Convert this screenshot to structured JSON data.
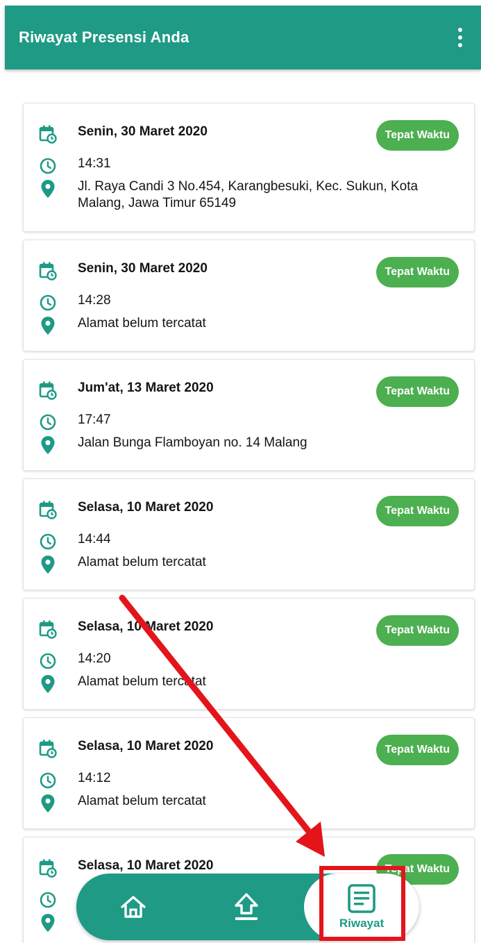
{
  "appbar": {
    "title": "Riwayat Presensi Anda",
    "menu_icon": "more-vert-icon"
  },
  "records": [
    {
      "date": "Senin, 30 Maret 2020",
      "time": "14:31",
      "address": "Jl. Raya Candi 3 No.454, Karangbesuki, Kec. Sukun, Kota Malang, Jawa Timur 65149",
      "status": "Tepat Waktu"
    },
    {
      "date": "Senin, 30 Maret 2020",
      "time": "14:28",
      "address": "Alamat belum tercatat",
      "status": "Tepat Waktu"
    },
    {
      "date": "Jum'at, 13 Maret 2020",
      "time": "17:47",
      "address": "Jalan Bunga Flamboyan no. 14 Malang",
      "status": "Tepat Waktu"
    },
    {
      "date": "Selasa, 10 Maret 2020",
      "time": "14:44",
      "address": "Alamat belum tercatat",
      "status": "Tepat Waktu"
    },
    {
      "date": "Selasa, 10 Maret 2020",
      "time": "14:20",
      "address": "Alamat belum tercatat",
      "status": "Tepat Waktu"
    },
    {
      "date": "Selasa, 10 Maret 2020",
      "time": "14:12",
      "address": "Alamat belum tercatat",
      "status": "Tepat Waktu"
    },
    {
      "date": "Selasa, 10 Maret 2020",
      "time": "",
      "address": "",
      "status": "Tepat Waktu"
    }
  ],
  "nav": {
    "items": [
      {
        "icon": "home-icon"
      },
      {
        "icon": "upload-icon"
      },
      {
        "icon": "document-list-icon",
        "label": "Riwayat",
        "active": true
      }
    ]
  },
  "colors": {
    "primary": "#1e9a85",
    "badge": "#4caf50",
    "annotation": "#e3151b"
  }
}
